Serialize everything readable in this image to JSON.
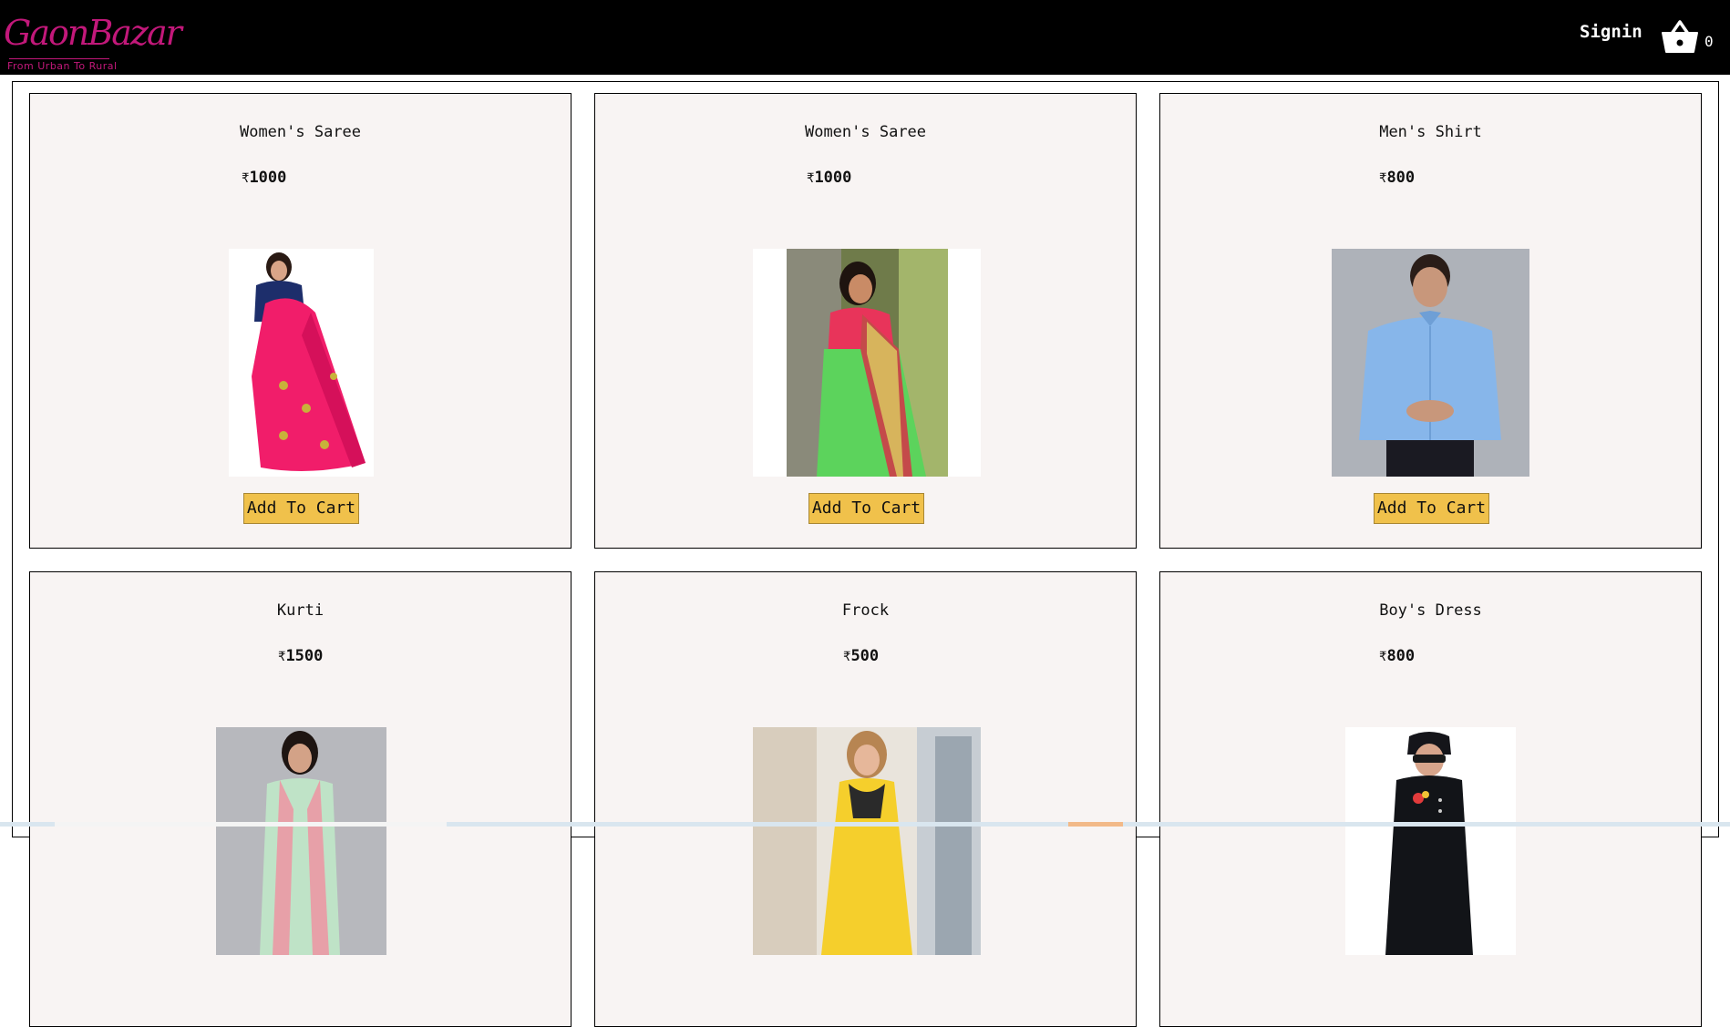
{
  "header": {
    "logo_text": "GaonBazar",
    "logo_tagline": "From Urban To Rural",
    "signin_label": "Signin",
    "cart_count": "0"
  },
  "currency_symbol": "₹",
  "add_to_cart_label": "Add To Cart",
  "products": [
    {
      "name": "Women's Saree",
      "price": "1000",
      "image": "pink-saree-image"
    },
    {
      "name": "Women's Saree",
      "price": "1000",
      "image": "green-saree-image"
    },
    {
      "name": "Men's Shirt",
      "price": "800",
      "image": "blue-shirt-image"
    },
    {
      "name": "Kurti",
      "price": "1500",
      "image": "kurti-image"
    },
    {
      "name": "Frock",
      "price": "500",
      "image": "frock-image"
    },
    {
      "name": "Boy's Dress",
      "price": "800",
      "image": "boys-dress-image"
    }
  ],
  "colors": {
    "header_bg": "#000000",
    "brand": "#c2187a",
    "card_bg": "#f8f4f3",
    "button_bg": "#f0c14b"
  }
}
